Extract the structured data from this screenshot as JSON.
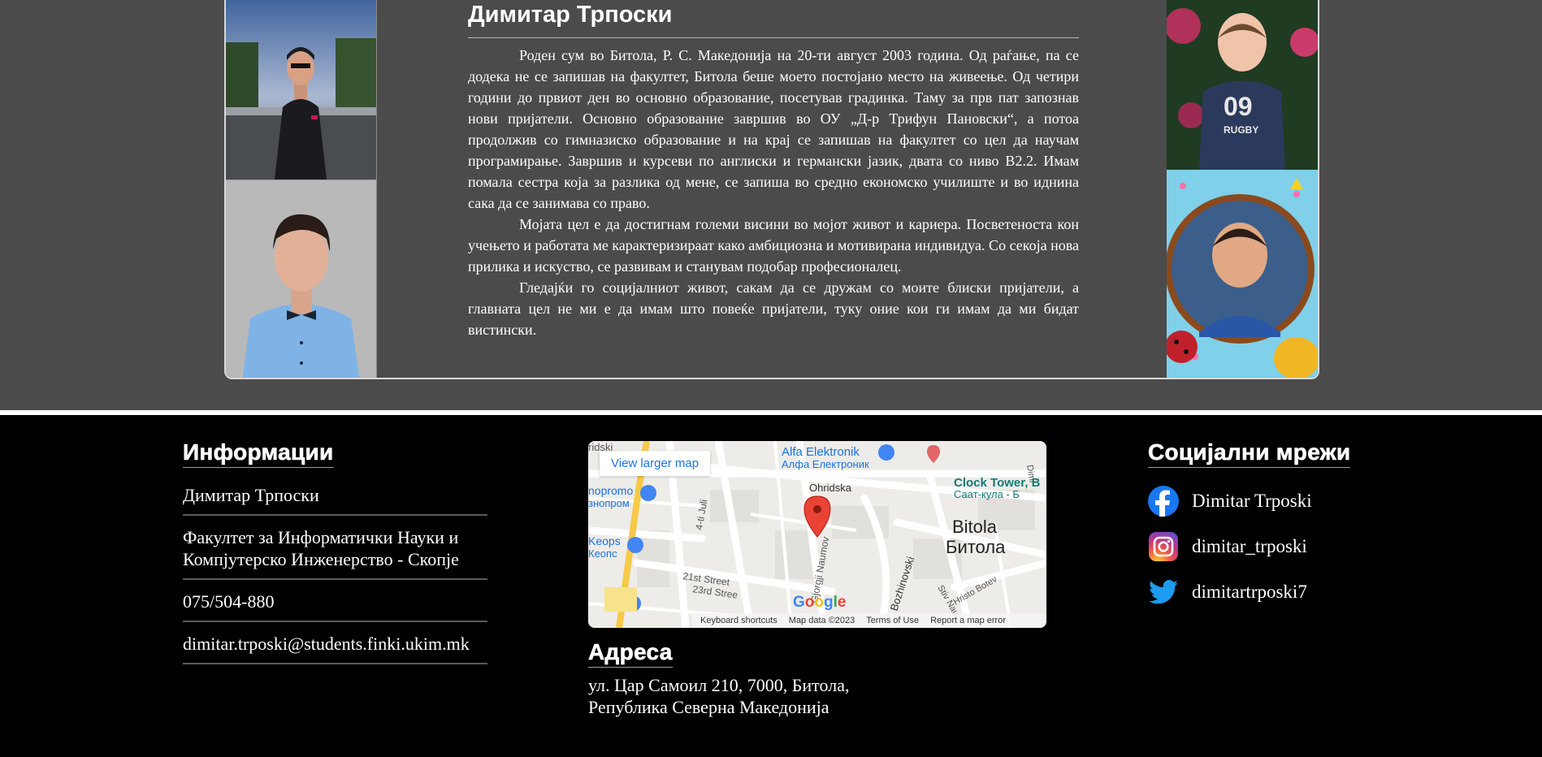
{
  "bio": {
    "title": "Димитар Трпоски",
    "paragraphs": [
      "Роден сум во Битола, Р. С. Македонија на 20-ти август 2003 година. Од раѓање, па се додека не се запишав на факултет, Битола беше моето постојано место на живеење. Од четири години до првиот ден во основно образование, посетував градинка. Таму за прв пат запознав нови пријатели. Основно образование завршив во ОУ „Д-р Трифун Пановски“, а потоа продолжив со гимназиско образование и на крај се запишав на факултет со цел да научам програмирање. Завршив и курсеви по англиски и германски јазик, двата со ниво В2.2. Имам помала сестра која за разлика од мене, се запиша во средно економско училиште и во иднина сака да се занимава со право.",
      "Мојата цел е да достигнам големи висини во мојот живот и кариера. Посветеноста кон учењето и работата ме карактеризираат како амбициозна и мотивирана индивидуа. Со секоја нова прилика и искуство, се развивам и станувам подобар професионалец.",
      "Гледајќи го социјалниот живот, сакам да се дружам со моите блиски пријатели, а главната цел не ми е да имам што повеќе пријатели, туку оние кои ги имам да ми бидат вистински."
    ]
  },
  "footer": {
    "info": {
      "heading": "Информации",
      "items": [
        "Димитар Трпоски",
        "Факултет за Информатички Науки и Компјутерско Инженерство - Скопје",
        "075/504-880",
        "dimitar.trposki@students.finki.ukim.mk"
      ]
    },
    "map": {
      "view_larger": "View larger map",
      "labels": {
        "alfa_en": "Alfa Elektronik",
        "alfa_mk": "Алфа Електроник",
        "ohridska": "Ohridska",
        "clock_en": "Clock Tower, B",
        "clock_mk": "Саат-кула - Б",
        "bitola_en": "Bitola",
        "bitola_mk": "Битола",
        "promo_en": "nopromo",
        "promo_mk": "знопром",
        "keops_en": "Keops",
        "keops_mk": "Кеопс",
        "street_4": "4-ti Juli",
        "street_21": "21st Street",
        "street_23": "23rd Stree",
        "gjorgji": "Gjorgji Naumov",
        "bozhinovski": "Bozhinovski",
        "stiv": "Stiv Nau",
        "hristo": "Hristo Botev",
        "dimi": "Dimi",
        "rid": "ridski"
      },
      "google": "Google",
      "footer_items": [
        "Keyboard shortcuts",
        "Map data ©2023",
        "Terms of Use",
        "Report a map error"
      ]
    },
    "address": {
      "heading": "Адреса",
      "line1": "ул. Цар Самоил 210, 7000, Битола,",
      "line2": "Република Северна Македонија"
    },
    "social": {
      "heading": "Социјални мрежи",
      "items": [
        {
          "icon": "facebook-icon",
          "label": "Dimitar Trposki"
        },
        {
          "icon": "instagram-icon",
          "label": "dimitar_trposki"
        },
        {
          "icon": "twitter-icon",
          "label": "dimitartrposki7"
        }
      ]
    }
  },
  "colors": {
    "page_bg": "#4b4b4b",
    "footer_bg": "#000000",
    "text": "#ffffff",
    "link_blue": "#1a73e8",
    "facebook": "#1877f2",
    "twitter": "#1d9bf0"
  }
}
